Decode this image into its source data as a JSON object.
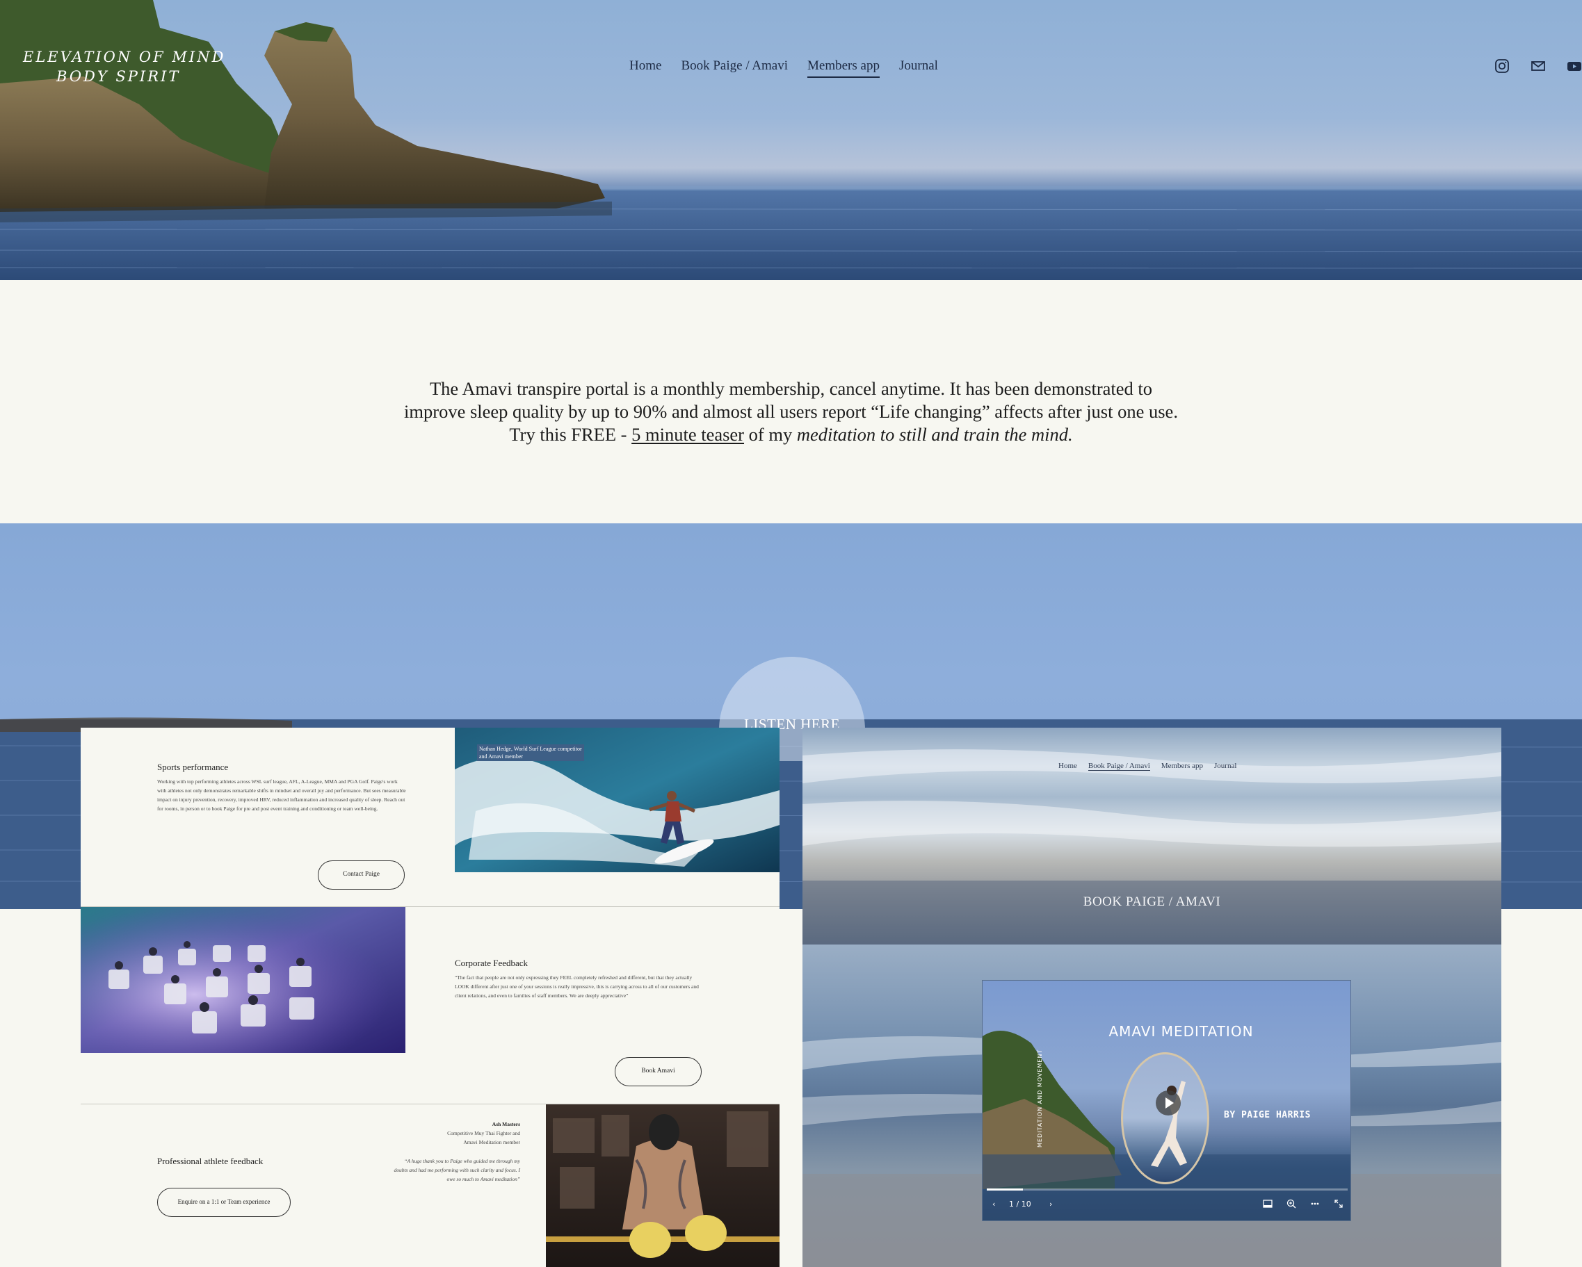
{
  "site": {
    "logo_line1": "ELEVATION OF MIND",
    "logo_line2": "BODY SPIRIT"
  },
  "nav": {
    "items": [
      {
        "label": "Home",
        "active": false
      },
      {
        "label": "Book Paige / Amavi",
        "active": false
      },
      {
        "label": "Members app",
        "active": true
      },
      {
        "label": "Journal",
        "active": false
      }
    ]
  },
  "socials": [
    "instagram-icon",
    "email-icon",
    "youtube-icon"
  ],
  "intro": {
    "line1": "The Amavi transpire portal is a monthly membership, cancel anytime. It has been demonstrated to",
    "line2": "improve sleep quality by up to 90% and almost all users report “Life changing” affects after just one use.",
    "line3_pre": "Try this FREE - ",
    "line3_link": "5 minute teaser",
    "line3_mid": " of my ",
    "line3_em": "meditation to still and train the mind."
  },
  "listen": {
    "label": "LISTEN HERE"
  },
  "collage": {
    "sports": {
      "title": "Sports performance",
      "body": "Working with top performing athletes across WSL surf league, AFL, A-League, MMA and PGA Golf. Paige's work with athletes not only demonstrates remarkable shifts in mindset and overall joy and performance. But sees measurable impact on injury prevention, recovery, improved HRV, reduced inflammation and increased quality of sleep. Reach out for rooms, in person or to book Paige for pre and post event training and conditioning or team well-being.",
      "button": "Contact Paige",
      "photo_caption_1": "Nathan Hedge, World Surf League competitor",
      "photo_caption_2": "and Amavi member"
    },
    "corporate": {
      "title": "Corporate Feedback",
      "quote": "“The fact that people are not only expressing they FEEL completely refreshed and different, but that they actually LOOK different after just one of your sessions is really impressive, this is carrying across to all of our customers and client relations, and even to families of staff members. We are deeply appreciative”",
      "button": "Book Amavi"
    },
    "athlete": {
      "title": "Professional athlete feedback",
      "name": "Ash Masters",
      "role_line1": "Competitive Muy Thai Fighter and",
      "role_line2": "Amavi Meditation member",
      "quote_line1": "“A huge thank you to Paige who guided me through my",
      "quote_line2": "doubts and had me performing with such clarity and focus. I",
      "quote_line3": "owe so much to Amavi meditation”",
      "button": "Enquire on a 1:1 or Team experience"
    }
  },
  "preview": {
    "nav": [
      {
        "label": "Home",
        "active": false
      },
      {
        "label": "Book Paige / Amavi",
        "active": true
      },
      {
        "label": "Members app",
        "active": false
      },
      {
        "label": "Journal",
        "active": false
      }
    ],
    "title": "BOOK PAIGE / AMAVI",
    "video": {
      "title": "AMAVI MEDITATION",
      "by": "BY PAIGE HARRIS",
      "side_text": "MEDITATION AND MOVEMENT",
      "page": "1 / 10",
      "progress": 0.1
    }
  },
  "colors": {
    "nav_text": "#1d2b45",
    "sky": "#8eaedb",
    "cream": "#f7f7f1",
    "caption_bg": "#3e5f86"
  }
}
